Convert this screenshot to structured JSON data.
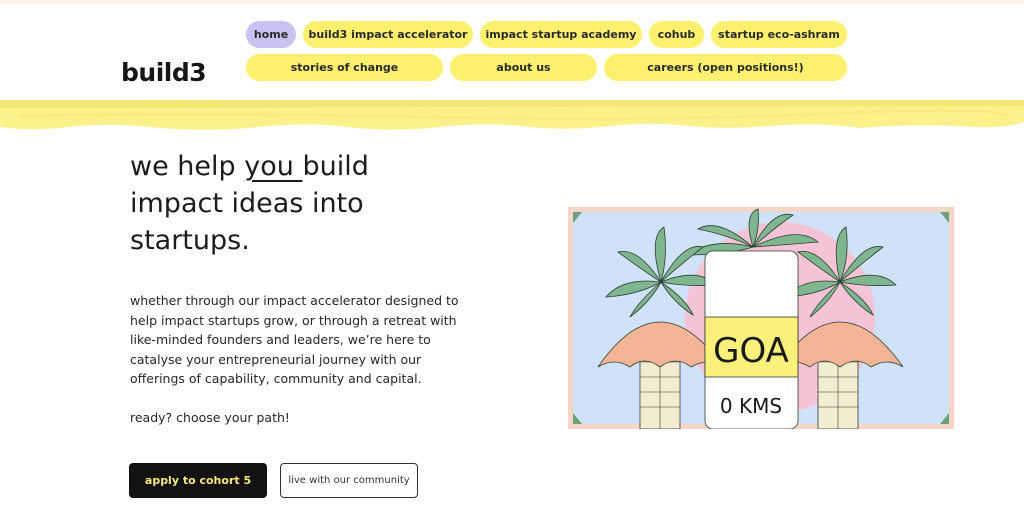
{
  "brand": {
    "logo_text": "build3"
  },
  "nav": {
    "row1": [
      {
        "label": "home",
        "active": true
      },
      {
        "label": "build3 impact accelerator",
        "active": false
      },
      {
        "label": "impact startup academy",
        "active": false
      },
      {
        "label": "cohub",
        "active": false
      },
      {
        "label": "startup eco-ashram",
        "active": false
      }
    ],
    "row2": [
      {
        "label": "stories of change"
      },
      {
        "label": "about us"
      },
      {
        "label": "careers (open positions!)"
      }
    ]
  },
  "hero": {
    "title_pre": "we help ",
    "title_emphasis": "you ",
    "title_post": "build impact ideas into startups.",
    "description": "whether through our impact accelerator designed to help impact startups grow, or through a retreat with like-minded founders and leaders, we’re here to catalyse your entrepreneurial journey with our offerings of capability, community and capital.",
    "prompt": "ready? choose your path!"
  },
  "cta": {
    "primary_label": "apply to cohort 5",
    "secondary_label": "live with our community"
  },
  "illustration": {
    "sign_top": "GOA",
    "sign_bottom": "0 KMS"
  },
  "colors": {
    "accent_yellow": "#fdf06e",
    "nav_active": "#c9c1f0",
    "illustration_sky": "#cfe2f7",
    "illustration_frame": "#f5d6c6"
  }
}
